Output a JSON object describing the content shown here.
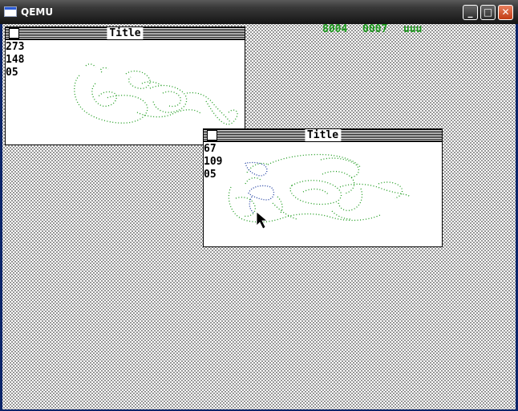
{
  "host": {
    "title": "QEMU"
  },
  "status": {
    "left": "8004",
    "middle": "0007",
    "right": "uuu"
  },
  "windows": [
    {
      "title": "Title",
      "lines": [
        "273",
        "148",
        "05"
      ]
    },
    {
      "title": "Title",
      "lines": [
        "67",
        "109",
        "05"
      ]
    }
  ],
  "colors": {
    "stroke_green": "#1a9a1a",
    "stroke_blue": "#1a3aa0",
    "status_green": "#1a9a1a"
  }
}
